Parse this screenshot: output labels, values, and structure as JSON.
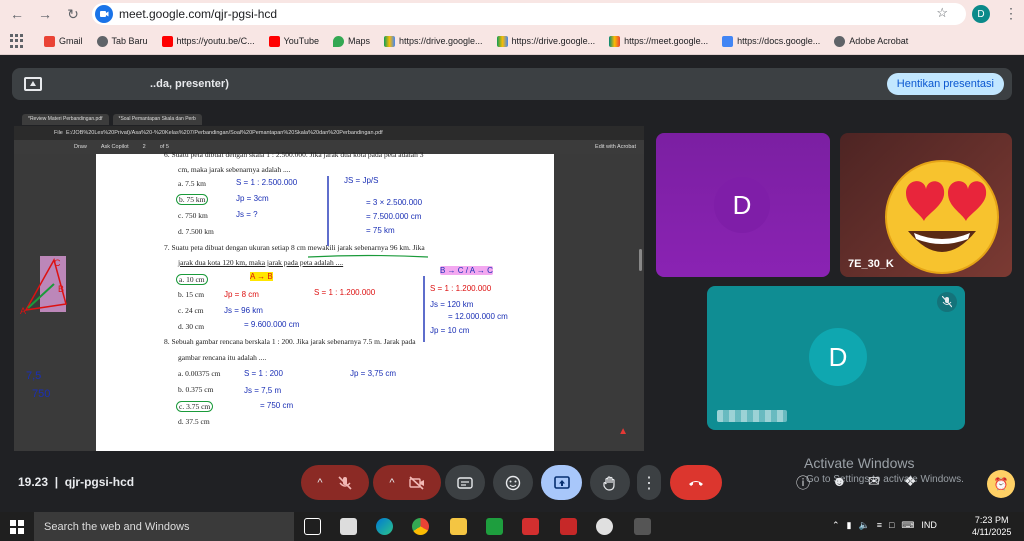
{
  "browser": {
    "url": "meet.google.com/qjr-pgsi-hcd",
    "profile_initial": "D",
    "bookmarks": [
      {
        "label": "Gmail",
        "color": "#ea4335"
      },
      {
        "label": "Tab Baru",
        "color": "#5f6368"
      },
      {
        "label": "https://youtu.be/C...",
        "color": "#ff0000"
      },
      {
        "label": "YouTube",
        "color": "#ff0000"
      },
      {
        "label": "Maps",
        "color": "#34a853"
      },
      {
        "label": "https://drive.google...",
        "color": "#fbbc04"
      },
      {
        "label": "https://drive.google...",
        "color": "#fbbc04"
      },
      {
        "label": "https://meet.google...",
        "color": "#00897b"
      },
      {
        "label": "https://docs.google...",
        "color": "#4285f4"
      },
      {
        "label": "Adobe Acrobat",
        "color": "#5f6368"
      }
    ]
  },
  "meet": {
    "presenter_text": "..da, presenter)",
    "stop_button": "Hentikan presentasi",
    "time": "19.23",
    "meeting_code": "qjr-pgsi-hcd",
    "watermark_title": "Activate Windows",
    "watermark_sub": "Go to Settings to activate Windows.",
    "participants": [
      {
        "initial": "D",
        "color": "#7b1fa2"
      },
      {
        "name": "7E_30_K",
        "color": "#6b302c"
      },
      {
        "initial": "D",
        "color": "#0f8d93"
      }
    ]
  },
  "shared_screen": {
    "tabs": [
      "*Review Materi Perbandingan.pdf",
      "*Soal Pemantapan Skala dan Perb"
    ],
    "file_label": "File",
    "path": "E:/JOB%20Les%20Privat)/Asa%20-%20Kelas%207/Perbandingan/Soal%20Pemantapan%20Skala%20dan%20Perbandingan.pdf",
    "tool_draw": "Draw",
    "tool_copilot": "Ask Copilot",
    "page_num": "2",
    "page_total": "of 5",
    "edit_acrobat": "Edit with Acrobat",
    "lines": {
      "q6_head": "6.   Suatu peta dibuat dengan skala 1 : 2.500.000. Jika jarak dua kota pada peta adalah 3",
      "q6_cont": "cm, maka jarak sebenarnya adalah ....",
      "q6_a": "a.  7.5 km",
      "q6_b": "b.  75 km",
      "q6_c": "c.  750 km",
      "q6_d": "d.  7.500 km",
      "q7_head": "7.   Suatu peta dibuat dengan ukuran setiap 8 cm mewakili jarak sebenarnya 96 km. Jika",
      "q7_cont": "jarak dua kota 120 km, maka jarak pada peta adalah ....",
      "q7_a": "a.  10 cm",
      "q7_b": "b.  15 cm",
      "q7_c": "c.  24 cm",
      "q7_d": "d.  30 cm",
      "q8_head": "8.   Sebuah gambar rencana berskala 1 : 200. Jika jarak sebenarnya 7.5 m. Jarak pada",
      "q8_cont": "gambar rencana itu adalah ....",
      "q8_a": "a.  0.00375 cm",
      "q8_b": "b.  0.375 cm",
      "q8_c": "c.  3.75 cm",
      "q8_d": "d.  37.5 cm"
    },
    "annotations": {
      "s1": "S = 1 : 2.500.000",
      "js1": "JS = Jp/S",
      "jp1": "Jp = 3cm",
      "js1q": "Js = ?",
      "calc1a": "= 3 × 2.500.000",
      "calc1b": "= 7.500.000 cm",
      "calc1c": "= 75 km",
      "bc": "B → C / A → C",
      "ab": "A → B",
      "jp2": "Jp = 8 cm",
      "js2": "Js = 96 km",
      "js2b": "= 9.600.000 cm",
      "s2": "S = 1 : 1.200.000",
      "s2b": "S = 1 : 1.200.000",
      "js2c": "Js = 120 km",
      "js2d": "= 12.000.000 cm",
      "jp2r": "Jp = 10 cm",
      "n750": "7,5",
      "n750b": "750",
      "s3": "S = 1 : 200",
      "js3": "Js = 7,5 m",
      "js3b": "= 750 cm",
      "jp3": "Jp = 3,75 cm"
    }
  },
  "taskbar": {
    "search": "Search the web and Windows",
    "lang": "IND",
    "time": "7:23 PM",
    "date": "4/11/2025"
  }
}
